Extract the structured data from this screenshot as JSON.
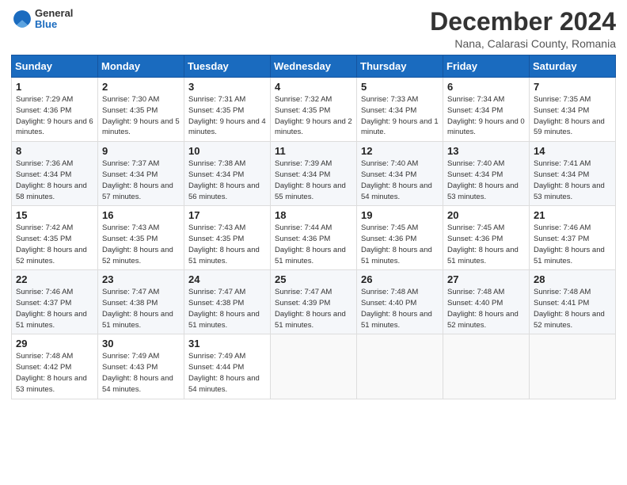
{
  "header": {
    "logo_general": "General",
    "logo_blue": "Blue",
    "month_title": "December 2024",
    "location": "Nana, Calarasi County, Romania"
  },
  "columns": [
    "Sunday",
    "Monday",
    "Tuesday",
    "Wednesday",
    "Thursday",
    "Friday",
    "Saturday"
  ],
  "weeks": [
    [
      {
        "day": "1",
        "sunrise": "Sunrise: 7:29 AM",
        "sunset": "Sunset: 4:36 PM",
        "daylight": "Daylight: 9 hours and 6 minutes."
      },
      {
        "day": "2",
        "sunrise": "Sunrise: 7:30 AM",
        "sunset": "Sunset: 4:35 PM",
        "daylight": "Daylight: 9 hours and 5 minutes."
      },
      {
        "day": "3",
        "sunrise": "Sunrise: 7:31 AM",
        "sunset": "Sunset: 4:35 PM",
        "daylight": "Daylight: 9 hours and 4 minutes."
      },
      {
        "day": "4",
        "sunrise": "Sunrise: 7:32 AM",
        "sunset": "Sunset: 4:35 PM",
        "daylight": "Daylight: 9 hours and 2 minutes."
      },
      {
        "day": "5",
        "sunrise": "Sunrise: 7:33 AM",
        "sunset": "Sunset: 4:34 PM",
        "daylight": "Daylight: 9 hours and 1 minute."
      },
      {
        "day": "6",
        "sunrise": "Sunrise: 7:34 AM",
        "sunset": "Sunset: 4:34 PM",
        "daylight": "Daylight: 9 hours and 0 minutes."
      },
      {
        "day": "7",
        "sunrise": "Sunrise: 7:35 AM",
        "sunset": "Sunset: 4:34 PM",
        "daylight": "Daylight: 8 hours and 59 minutes."
      }
    ],
    [
      {
        "day": "8",
        "sunrise": "Sunrise: 7:36 AM",
        "sunset": "Sunset: 4:34 PM",
        "daylight": "Daylight: 8 hours and 58 minutes."
      },
      {
        "day": "9",
        "sunrise": "Sunrise: 7:37 AM",
        "sunset": "Sunset: 4:34 PM",
        "daylight": "Daylight: 8 hours and 57 minutes."
      },
      {
        "day": "10",
        "sunrise": "Sunrise: 7:38 AM",
        "sunset": "Sunset: 4:34 PM",
        "daylight": "Daylight: 8 hours and 56 minutes."
      },
      {
        "day": "11",
        "sunrise": "Sunrise: 7:39 AM",
        "sunset": "Sunset: 4:34 PM",
        "daylight": "Daylight: 8 hours and 55 minutes."
      },
      {
        "day": "12",
        "sunrise": "Sunrise: 7:40 AM",
        "sunset": "Sunset: 4:34 PM",
        "daylight": "Daylight: 8 hours and 54 minutes."
      },
      {
        "day": "13",
        "sunrise": "Sunrise: 7:40 AM",
        "sunset": "Sunset: 4:34 PM",
        "daylight": "Daylight: 8 hours and 53 minutes."
      },
      {
        "day": "14",
        "sunrise": "Sunrise: 7:41 AM",
        "sunset": "Sunset: 4:34 PM",
        "daylight": "Daylight: 8 hours and 53 minutes."
      }
    ],
    [
      {
        "day": "15",
        "sunrise": "Sunrise: 7:42 AM",
        "sunset": "Sunset: 4:35 PM",
        "daylight": "Daylight: 8 hours and 52 minutes."
      },
      {
        "day": "16",
        "sunrise": "Sunrise: 7:43 AM",
        "sunset": "Sunset: 4:35 PM",
        "daylight": "Daylight: 8 hours and 52 minutes."
      },
      {
        "day": "17",
        "sunrise": "Sunrise: 7:43 AM",
        "sunset": "Sunset: 4:35 PM",
        "daylight": "Daylight: 8 hours and 51 minutes."
      },
      {
        "day": "18",
        "sunrise": "Sunrise: 7:44 AM",
        "sunset": "Sunset: 4:36 PM",
        "daylight": "Daylight: 8 hours and 51 minutes."
      },
      {
        "day": "19",
        "sunrise": "Sunrise: 7:45 AM",
        "sunset": "Sunset: 4:36 PM",
        "daylight": "Daylight: 8 hours and 51 minutes."
      },
      {
        "day": "20",
        "sunrise": "Sunrise: 7:45 AM",
        "sunset": "Sunset: 4:36 PM",
        "daylight": "Daylight: 8 hours and 51 minutes."
      },
      {
        "day": "21",
        "sunrise": "Sunrise: 7:46 AM",
        "sunset": "Sunset: 4:37 PM",
        "daylight": "Daylight: 8 hours and 51 minutes."
      }
    ],
    [
      {
        "day": "22",
        "sunrise": "Sunrise: 7:46 AM",
        "sunset": "Sunset: 4:37 PM",
        "daylight": "Daylight: 8 hours and 51 minutes."
      },
      {
        "day": "23",
        "sunrise": "Sunrise: 7:47 AM",
        "sunset": "Sunset: 4:38 PM",
        "daylight": "Daylight: 8 hours and 51 minutes."
      },
      {
        "day": "24",
        "sunrise": "Sunrise: 7:47 AM",
        "sunset": "Sunset: 4:38 PM",
        "daylight": "Daylight: 8 hours and 51 minutes."
      },
      {
        "day": "25",
        "sunrise": "Sunrise: 7:47 AM",
        "sunset": "Sunset: 4:39 PM",
        "daylight": "Daylight: 8 hours and 51 minutes."
      },
      {
        "day": "26",
        "sunrise": "Sunrise: 7:48 AM",
        "sunset": "Sunset: 4:40 PM",
        "daylight": "Daylight: 8 hours and 51 minutes."
      },
      {
        "day": "27",
        "sunrise": "Sunrise: 7:48 AM",
        "sunset": "Sunset: 4:40 PM",
        "daylight": "Daylight: 8 hours and 52 minutes."
      },
      {
        "day": "28",
        "sunrise": "Sunrise: 7:48 AM",
        "sunset": "Sunset: 4:41 PM",
        "daylight": "Daylight: 8 hours and 52 minutes."
      }
    ],
    [
      {
        "day": "29",
        "sunrise": "Sunrise: 7:48 AM",
        "sunset": "Sunset: 4:42 PM",
        "daylight": "Daylight: 8 hours and 53 minutes."
      },
      {
        "day": "30",
        "sunrise": "Sunrise: 7:49 AM",
        "sunset": "Sunset: 4:43 PM",
        "daylight": "Daylight: 8 hours and 54 minutes."
      },
      {
        "day": "31",
        "sunrise": "Sunrise: 7:49 AM",
        "sunset": "Sunset: 4:44 PM",
        "daylight": "Daylight: 8 hours and 54 minutes."
      },
      null,
      null,
      null,
      null
    ]
  ]
}
